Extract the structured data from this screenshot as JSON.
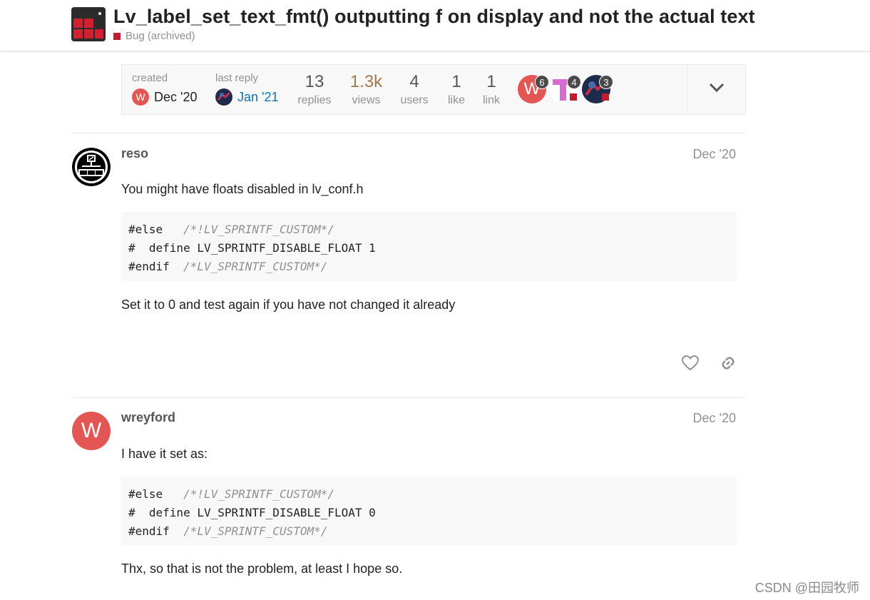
{
  "header": {
    "title": "Lv_label_set_text_fmt() outputting f on display and not the actual text",
    "category": "Bug (archived)",
    "category_color": "#c01e2e"
  },
  "topic_map": {
    "created_label": "created",
    "created_avatar_letter": "W",
    "created_date": "Dec '20",
    "last_reply_label": "last reply",
    "last_reply_date": "Jan '21",
    "stats": [
      {
        "num": "13",
        "label": "replies"
      },
      {
        "num": "1.3k",
        "label": "views"
      },
      {
        "num": "4",
        "label": "users"
      },
      {
        "num": "1",
        "label": "like"
      },
      {
        "num": "1",
        "label": "link"
      }
    ],
    "participants": [
      {
        "letter": "W",
        "count": "6",
        "color": "#e45653"
      },
      {
        "letter": "T",
        "count": "4",
        "color": "#d66bd0"
      },
      {
        "letter": "",
        "count": "3",
        "color": "#1d2b4d"
      }
    ]
  },
  "posts": [
    {
      "username": "reso",
      "date": "Dec '20",
      "avatar_text": "CAN",
      "text_before": "You might have floats disabled in lv_conf.h",
      "code": [
        {
          "code": "#else",
          "comment": "/*!LV_SPRINTF_CUSTOM*/"
        },
        {
          "code": "#  define LV_SPRINTF_DISABLE_FLOAT 1",
          "comment": ""
        },
        {
          "code": "#endif",
          "comment": "/*LV_SPRINTF_CUSTOM*/"
        }
      ],
      "text_after": "Set it to 0 and test again if you have not changed it already"
    },
    {
      "username": "wreyford",
      "date": "Dec '20",
      "avatar_letter": "W",
      "avatar_color": "#e45653",
      "text_before": "I have it set as:",
      "code": [
        {
          "code": "#else",
          "comment": "/*!LV_SPRINTF_CUSTOM*/"
        },
        {
          "code": "#  define LV_SPRINTF_DISABLE_FLOAT 0",
          "comment": ""
        },
        {
          "code": "#endif",
          "comment": "/*LV_SPRINTF_CUSTOM*/"
        }
      ],
      "text_after": "Thx, so that is not the problem, at least I hope so."
    }
  ],
  "watermark": "CSDN @田园牧师"
}
